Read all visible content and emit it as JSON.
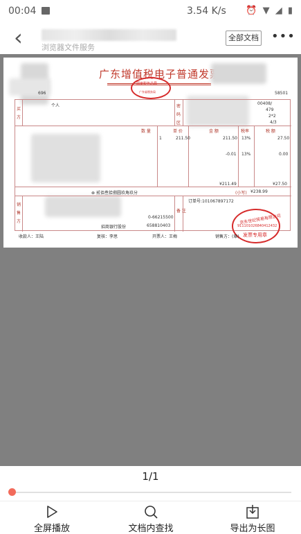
{
  "status_bar": {
    "time": "00:04",
    "speed": "3.54 K/s"
  },
  "nav": {
    "subtitle": "浏览器文件服务",
    "all_docs_label": "全部文档",
    "more_label": "•••"
  },
  "invoice": {
    "title": "广东增值税电子普通发票",
    "top_stamp_line1": "国家税务总局",
    "top_stamp_line2": "广东省税务局",
    "code_partial": "696",
    "code_right": "58501",
    "buyer_name_partial": "个人",
    "password_lines": [
      "00408/",
      "479",
      "2*2",
      "4/3"
    ],
    "col_quantity": "数 量",
    "col_unit_price": "单 价",
    "col_amount": "金 额",
    "col_tax_rate": "税率",
    "col_tax": "税 额",
    "row1_quantity": "1",
    "row1_unit_price": "211.50",
    "row1_amount": "211.50",
    "row1_tax_rate": "13%",
    "row1_tax": "27.50",
    "row2_amount": "-0.01",
    "row2_tax_rate": "13%",
    "row2_tax": "0.00",
    "total_amount": "¥211.49",
    "total_tax": "¥27.50",
    "total_words": "贰佰叁拾捌圆玖角玖分",
    "total_small_label": "(小写)",
    "total_small_value": "¥238.99",
    "order_no": "订单号:101067897172",
    "seller_bank": "招商银行股份",
    "seller_account": "658810403",
    "seller_phone": "0-66215500",
    "remark_label": "备 注",
    "payee": "收款人：王陆",
    "reviewer": "复核：李思",
    "issuer": "开票人：王梅",
    "seller_sign": "销售方：(章)",
    "seal_line1": "京东世纪贸易有限公司",
    "seal_line2": "911101026840412432",
    "seal_line3": "发票专用章"
  },
  "pager": {
    "indicator": "1/1",
    "progress": 0.0
  },
  "toolbar": {
    "play_label": "全屏播放",
    "search_label": "文档内查找",
    "export_label": "导出为长图"
  },
  "colors": {
    "accent": "#f26b5b",
    "stamp_red": "#d62b2b",
    "viewer_bg": "#808080"
  }
}
